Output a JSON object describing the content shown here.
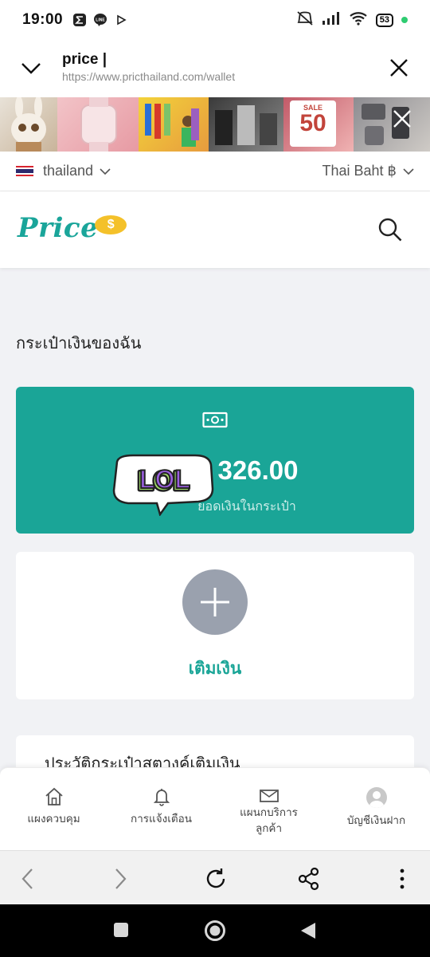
{
  "status_bar": {
    "time": "19:00",
    "battery": "53"
  },
  "url_bar": {
    "title": "price |",
    "url": "https://www.pricthailand.com/wallet"
  },
  "banner": {
    "sale_small": "SALE",
    "sale_number": "50"
  },
  "region": {
    "country": "thailand",
    "currency": "Thai Baht ฿"
  },
  "logo": {
    "word": "Price",
    "coin": "$"
  },
  "wallet": {
    "heading": "กระเป๋าเงินของฉัน",
    "amount": "326.00",
    "amount_label": "ยอดเงินในกระเป๋า",
    "sticker": "LOL",
    "topup_label": "เติมเงิน",
    "history_title": "ประวัติกระเป๋าสตางค์เติมเงิน"
  },
  "bottom_nav": {
    "dashboard": "แผงควบคุม",
    "notifications": "การแจ้งเตือน",
    "service_plan_line1": "แผนกบริการ",
    "service_plan_line2": "ลูกค้า",
    "account": "บัญชีเงินฝาก"
  },
  "colors": {
    "accent": "#1aa597",
    "plus_button": "#9aa1ae",
    "logo_coin": "#f4c12a"
  }
}
